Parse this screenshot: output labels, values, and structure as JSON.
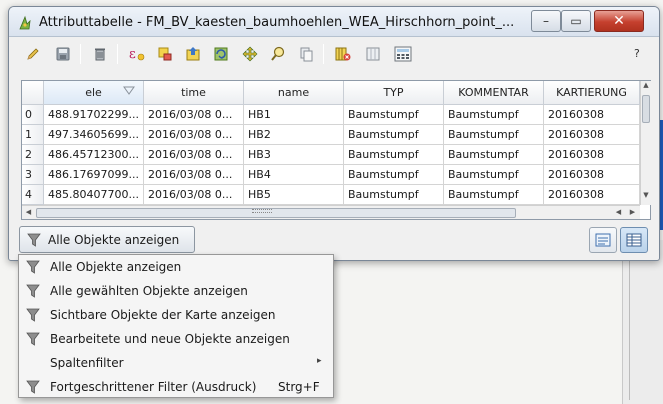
{
  "window": {
    "title": "Attributtabelle - FM_BV_kaesten_baumhoehlen_WEA_Hirschhorn_point_...",
    "minimize_glyph": "–",
    "maximize_glyph": "▭",
    "close_glyph": "✕"
  },
  "toolbar": {
    "icons": [
      "pencil-icon",
      "save-icon",
      "delete-icon",
      "expression-select-icon",
      "deselect-icon",
      "move-selection-top-icon",
      "invert-selection-icon",
      "pan-to-selection-icon",
      "zoom-to-selection-icon",
      "copy-rows-icon",
      "delete-column-icon",
      "new-column-icon",
      "field-calculator-icon"
    ],
    "help_label": "?"
  },
  "table": {
    "columns": [
      "ele",
      "time",
      "name",
      "TYP",
      "KOMMENTAR",
      "KARTIERUNG"
    ],
    "sorted_column": "ele",
    "rows": [
      {
        "index": "0",
        "cells": [
          "488.91702299...",
          "2016/03/08 0...",
          "HB1",
          "Baumstumpf",
          "Baumstumpf",
          "20160308"
        ]
      },
      {
        "index": "1",
        "cells": [
          "497.34605699...",
          "2016/03/08 0...",
          "HB2",
          "Baumstumpf",
          "Baumstumpf",
          "20160308"
        ]
      },
      {
        "index": "2",
        "cells": [
          "486.45712300...",
          "2016/03/08 0...",
          "HB3",
          "Baumstumpf",
          "Baumstumpf",
          "20160308"
        ]
      },
      {
        "index": "3",
        "cells": [
          "486.17697099...",
          "2016/03/08 0...",
          "HB4",
          "Baumstumpf",
          "Baumstumpf",
          "20160308"
        ]
      },
      {
        "index": "4",
        "cells": [
          "485.80407700...",
          "2016/03/08 0...",
          "HB5",
          "Baumstumpf",
          "Baumstumpf",
          "20160308"
        ]
      }
    ]
  },
  "filter_button": {
    "label": "Alle Objekte anzeigen"
  },
  "filter_menu": {
    "items": [
      {
        "label": "Alle Objekte anzeigen",
        "shortcut": "",
        "has_icon": true,
        "submenu": false
      },
      {
        "label": "Alle gewählten Objekte anzeigen",
        "shortcut": "",
        "has_icon": true,
        "submenu": false
      },
      {
        "label": "Sichtbare Objekte der Karte anzeigen",
        "shortcut": "",
        "has_icon": true,
        "submenu": false
      },
      {
        "label": "Bearbeitete und neue Objekte anzeigen",
        "shortcut": "",
        "has_icon": true,
        "submenu": false
      },
      {
        "label": "Spaltenfilter",
        "shortcut": "",
        "has_icon": false,
        "submenu": true
      },
      {
        "label": "Fortgeschrittener Filter (Ausdruck)",
        "shortcut": "Strg+F",
        "has_icon": true,
        "submenu": false
      }
    ]
  },
  "colors": {
    "close_button": "#c5402e",
    "active_view_button": "#b9d2ea",
    "map_blue_strip": "#1d5fbf"
  }
}
